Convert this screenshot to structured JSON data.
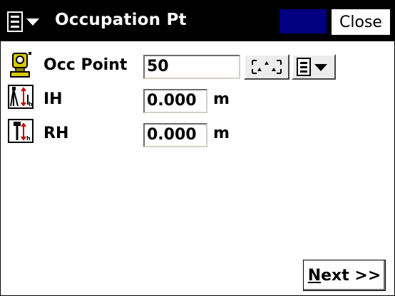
{
  "titlebar": {
    "title": "Occupation Pt",
    "close_label": "Close",
    "accent": "#000080"
  },
  "occ_point": {
    "label": "Occ Point",
    "value": "50",
    "icon": "total-station-icon"
  },
  "ih": {
    "label": "IH",
    "value": "0.000",
    "unit": "m",
    "icon": "instrument-height-icon"
  },
  "rh": {
    "label": "RH",
    "value": "0.000",
    "unit": "m",
    "icon": "rod-height-icon"
  },
  "footer": {
    "next_label_first": "N",
    "next_label_rest": "ext >>"
  }
}
